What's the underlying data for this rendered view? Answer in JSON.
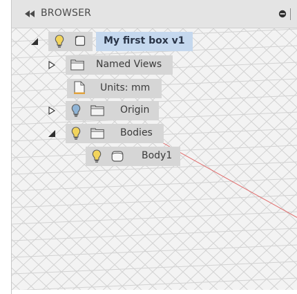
{
  "header": {
    "title": "BROWSER"
  },
  "tree": {
    "root": {
      "label": "My first box v1"
    },
    "named_views": {
      "label": "Named Views"
    },
    "units": {
      "label": "Units: mm"
    },
    "origin": {
      "label": "Origin"
    },
    "bodies": {
      "label": "Bodies"
    },
    "body1": {
      "label": "Body1"
    }
  },
  "icons": {
    "collapse": "double-left-arrow-icon",
    "pin": "pin-icon",
    "expanded": "triangle-expanded-icon",
    "collapsed": "triangle-collapsed-icon",
    "visibility_on": "lightbulb-on-icon",
    "visibility_off": "lightbulb-off-icon",
    "component": "component-icon",
    "folder": "folder-icon",
    "document": "document-icon",
    "body": "body-icon"
  },
  "colors": {
    "selected_highlight": "#c5d8ee",
    "row_chip": "#d6d6d6",
    "lightbulb_on": "#f2d45c",
    "lightbulb_off": "#8fb4d6",
    "axis_line": "#e06a6a"
  }
}
